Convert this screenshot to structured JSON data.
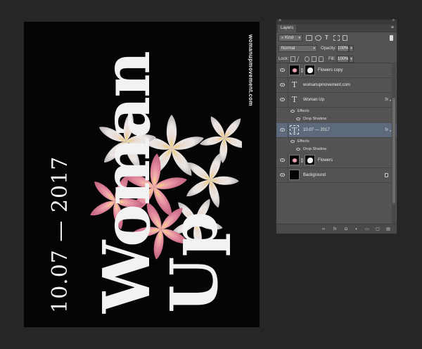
{
  "poster": {
    "url": "womanupmovement.com",
    "date": "10.07 — 2017",
    "title_line1": "Woman",
    "title_line2": "Up",
    "background": "#050505",
    "text_color": "#f2f2f2"
  },
  "panel": {
    "close_glyph": "×",
    "collapse_glyph": "»",
    "tab": "Layers",
    "menu_glyph": "≡",
    "filter_label": "Kind",
    "filter_search_glyph": "⌕",
    "blend_mode": "Normal",
    "opacity_label": "Opacity:",
    "opacity_value": "100%",
    "lock_label": "Lock:",
    "fill_label": "Fill:",
    "fill_value": "100%",
    "fx_label": "fx",
    "dropdown_glyph": "▾",
    "text_thumb_glyph": "T",
    "layers": [
      {
        "name": "Flowers copy",
        "kind": "smart-mask"
      },
      {
        "name": "womanupmovement.com",
        "kind": "text"
      },
      {
        "name": "Woman Up",
        "kind": "text",
        "effects_label": "Effects",
        "effect": "Drop Shadow"
      },
      {
        "name": "10.07 — 2017",
        "kind": "text",
        "selected": true,
        "effects_label": "Effects",
        "effect": "Drop Shadow"
      },
      {
        "name": "Flowers",
        "kind": "smart-mask"
      },
      {
        "name": "Background",
        "kind": "background",
        "locked": true
      }
    ],
    "footer_icons": [
      "link-icon",
      "fx-icon",
      "mask-icon",
      "adjustment-icon",
      "folder-icon",
      "new-layer-icon",
      "trash-icon"
    ],
    "footer_glyphs": [
      "∞",
      "fx",
      "◘",
      "◐",
      "▭",
      "▢",
      "▤"
    ],
    "accent_selected": "#5d6a7c"
  }
}
